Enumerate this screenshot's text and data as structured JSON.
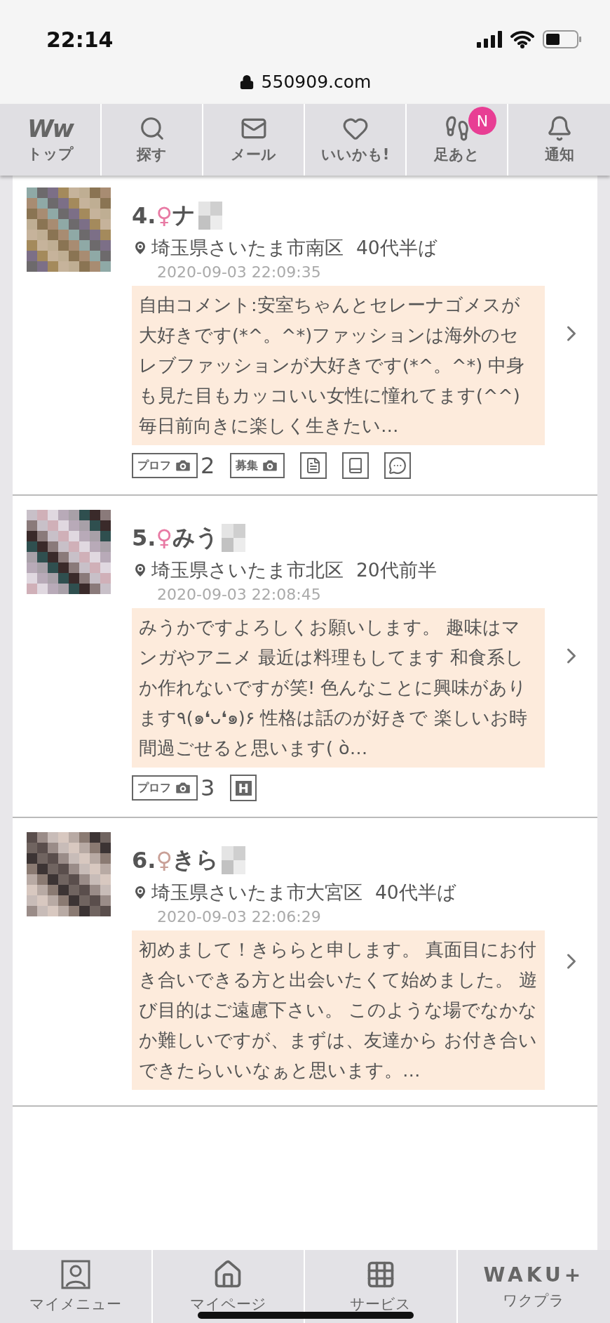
{
  "status_bar": {
    "time": "22:14",
    "url": "550909.com"
  },
  "top_nav": [
    {
      "kind": "logo",
      "logo": "Ww",
      "label": "トップ"
    },
    {
      "kind": "search",
      "label": "探す"
    },
    {
      "kind": "mail",
      "label": "メール"
    },
    {
      "kind": "heart",
      "label": "いいかも!"
    },
    {
      "kind": "footprints",
      "label": "足あと",
      "badge": "N"
    },
    {
      "kind": "bell",
      "label": "通知"
    }
  ],
  "profiles": [
    {
      "number": "4.",
      "symbol": "♀",
      "color": "#e87aa4",
      "name": "ナ",
      "location": "埼玉県さいたま市南区",
      "age": "40代半ば",
      "date": "2020-09-03 22:09:35",
      "comment": "自由コメント:安室ちゃんとセレーナゴメスが大好きです(*^。^*)ファッションは海外のセレブファッションが大好きです(*^。^*) 中身も見た目もカッコいい女性に憧れてます(^^) 毎日前向きに楽しく生きたい…",
      "badges": [
        {
          "label": "プロフ",
          "count": "2"
        },
        {
          "label": "募集"
        },
        {
          "kind": "document"
        },
        {
          "kind": "notebook"
        },
        {
          "kind": "chat"
        }
      ]
    },
    {
      "number": "5.",
      "symbol": "♀",
      "color": "#e87aa4",
      "name": "みう",
      "location": "埼玉県さいたま市北区",
      "age": "20代前半",
      "date": "2020-09-03 22:08:45",
      "comment": "みうかですよろしくお願いします。 趣味はマンガやアニメ 最近は料理もしてます 和食系しか作れないですが笑! 色んなことに興味があります٩(๑❛ᴗ❛๑)۶ 性格は話のが好きで 楽しいお時間過ごせると思います( ὸ…",
      "badges": [
        {
          "label": "プロフ",
          "count": "3"
        },
        {
          "kind": "letter",
          "letter": "H"
        }
      ]
    },
    {
      "number": "6.",
      "symbol": "♀",
      "color": "#c9a097",
      "name": "きら",
      "location": "埼玉県さいたま市大宮区",
      "age": "40代半ば",
      "date": "2020-09-03 22:06:29",
      "comment": "初めまして！きららと申します。 真面目にお付き合いできる方と出会いたくて始めました。 遊び目的はご遠慮下さい。 このような場でなかなか難しいですが、まずは、友達から お付き合いできたらいいなぁと思います。…"
    }
  ],
  "bottom_nav": [
    {
      "kind": "profile",
      "label": "マイメニュー"
    },
    {
      "kind": "home",
      "label": "マイページ"
    },
    {
      "kind": "grid",
      "label": "サービス"
    },
    {
      "kind": "brand",
      "logo": "WAKU+",
      "label": "ワクプラ"
    }
  ]
}
